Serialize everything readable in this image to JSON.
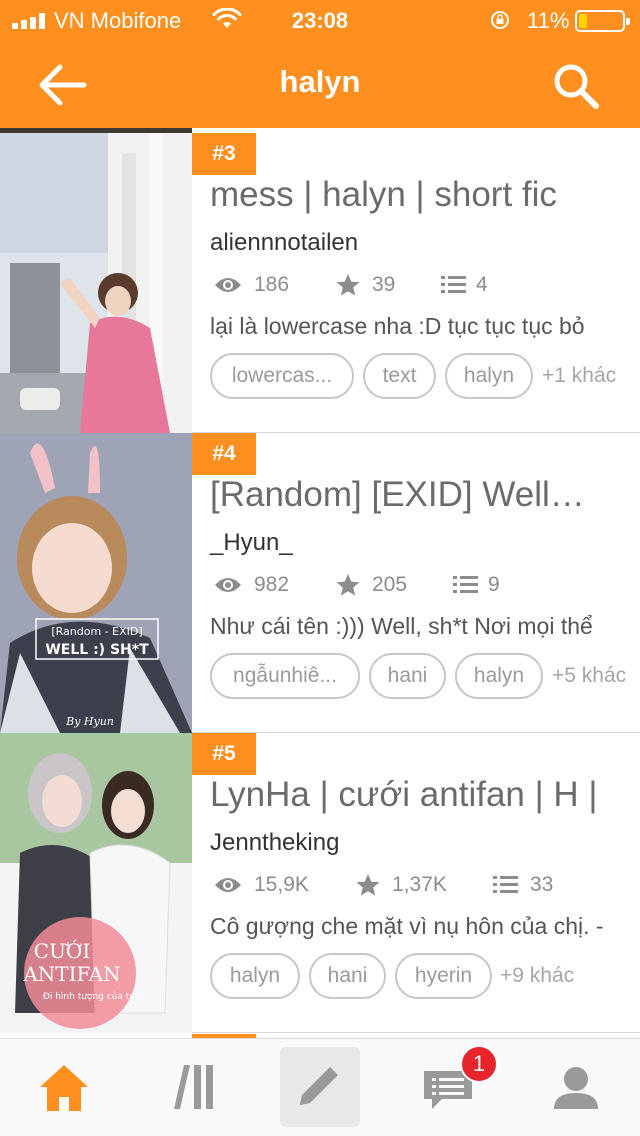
{
  "status_bar": {
    "carrier": "VN Mobifone",
    "time": "23:08",
    "battery": "11%",
    "battery_level": 0.11
  },
  "header": {
    "title": "halyn",
    "back_icon": "arrow-left-icon",
    "search_icon": "search-icon"
  },
  "stories": [
    {
      "rank": "#3",
      "title": " mess | halyn | short fic",
      "author": "aliennnotailen",
      "reads": "186",
      "votes": "39",
      "parts": "4",
      "description": "lại là lowercase nha :D tục tục tục bỏ",
      "tags": [
        "lowercas...",
        "text",
        "halyn"
      ],
      "more_tags": "+1 khác"
    },
    {
      "rank": "#4",
      "title": "[Random] [EXID] Well…",
      "author": "_Hyun_",
      "reads": "982",
      "votes": "205",
      "parts": "9",
      "description": "Như cái tên :))) Well, sh*t Nơi mọi thể",
      "tags": [
        "ngẫunhiê...",
        "hani",
        "halyn"
      ],
      "more_tags": "+5 khác",
      "cover_text_1": "[Random - EXID]",
      "cover_text_2": "WELL :) SH*T",
      "cover_text_3": "By Hyun"
    },
    {
      "rank": "#5",
      "title": "LynHa | cưới antifan | H |",
      "author": "Jenntheking",
      "reads": "15,9K",
      "votes": "1,37K",
      "parts": "33",
      "description": "Cô gượng che mặt vì nụ hôn của chị. -",
      "tags": [
        "halyn",
        "hani",
        "hyerin"
      ],
      "more_tags": "+9 khác",
      "cover_text_1": "CƯỚI",
      "cover_text_2": "ANTIFAN",
      "cover_text_3": "Đi hình tượng của tui!"
    }
  ],
  "bottom_nav": {
    "items": [
      "home-icon",
      "library-icon",
      "write-icon",
      "messages-icon",
      "profile-icon"
    ],
    "badge": "1",
    "accent": "#ff8f1f"
  },
  "colors": {
    "brand": "#ff8f1f",
    "badge": "#e8242c"
  }
}
